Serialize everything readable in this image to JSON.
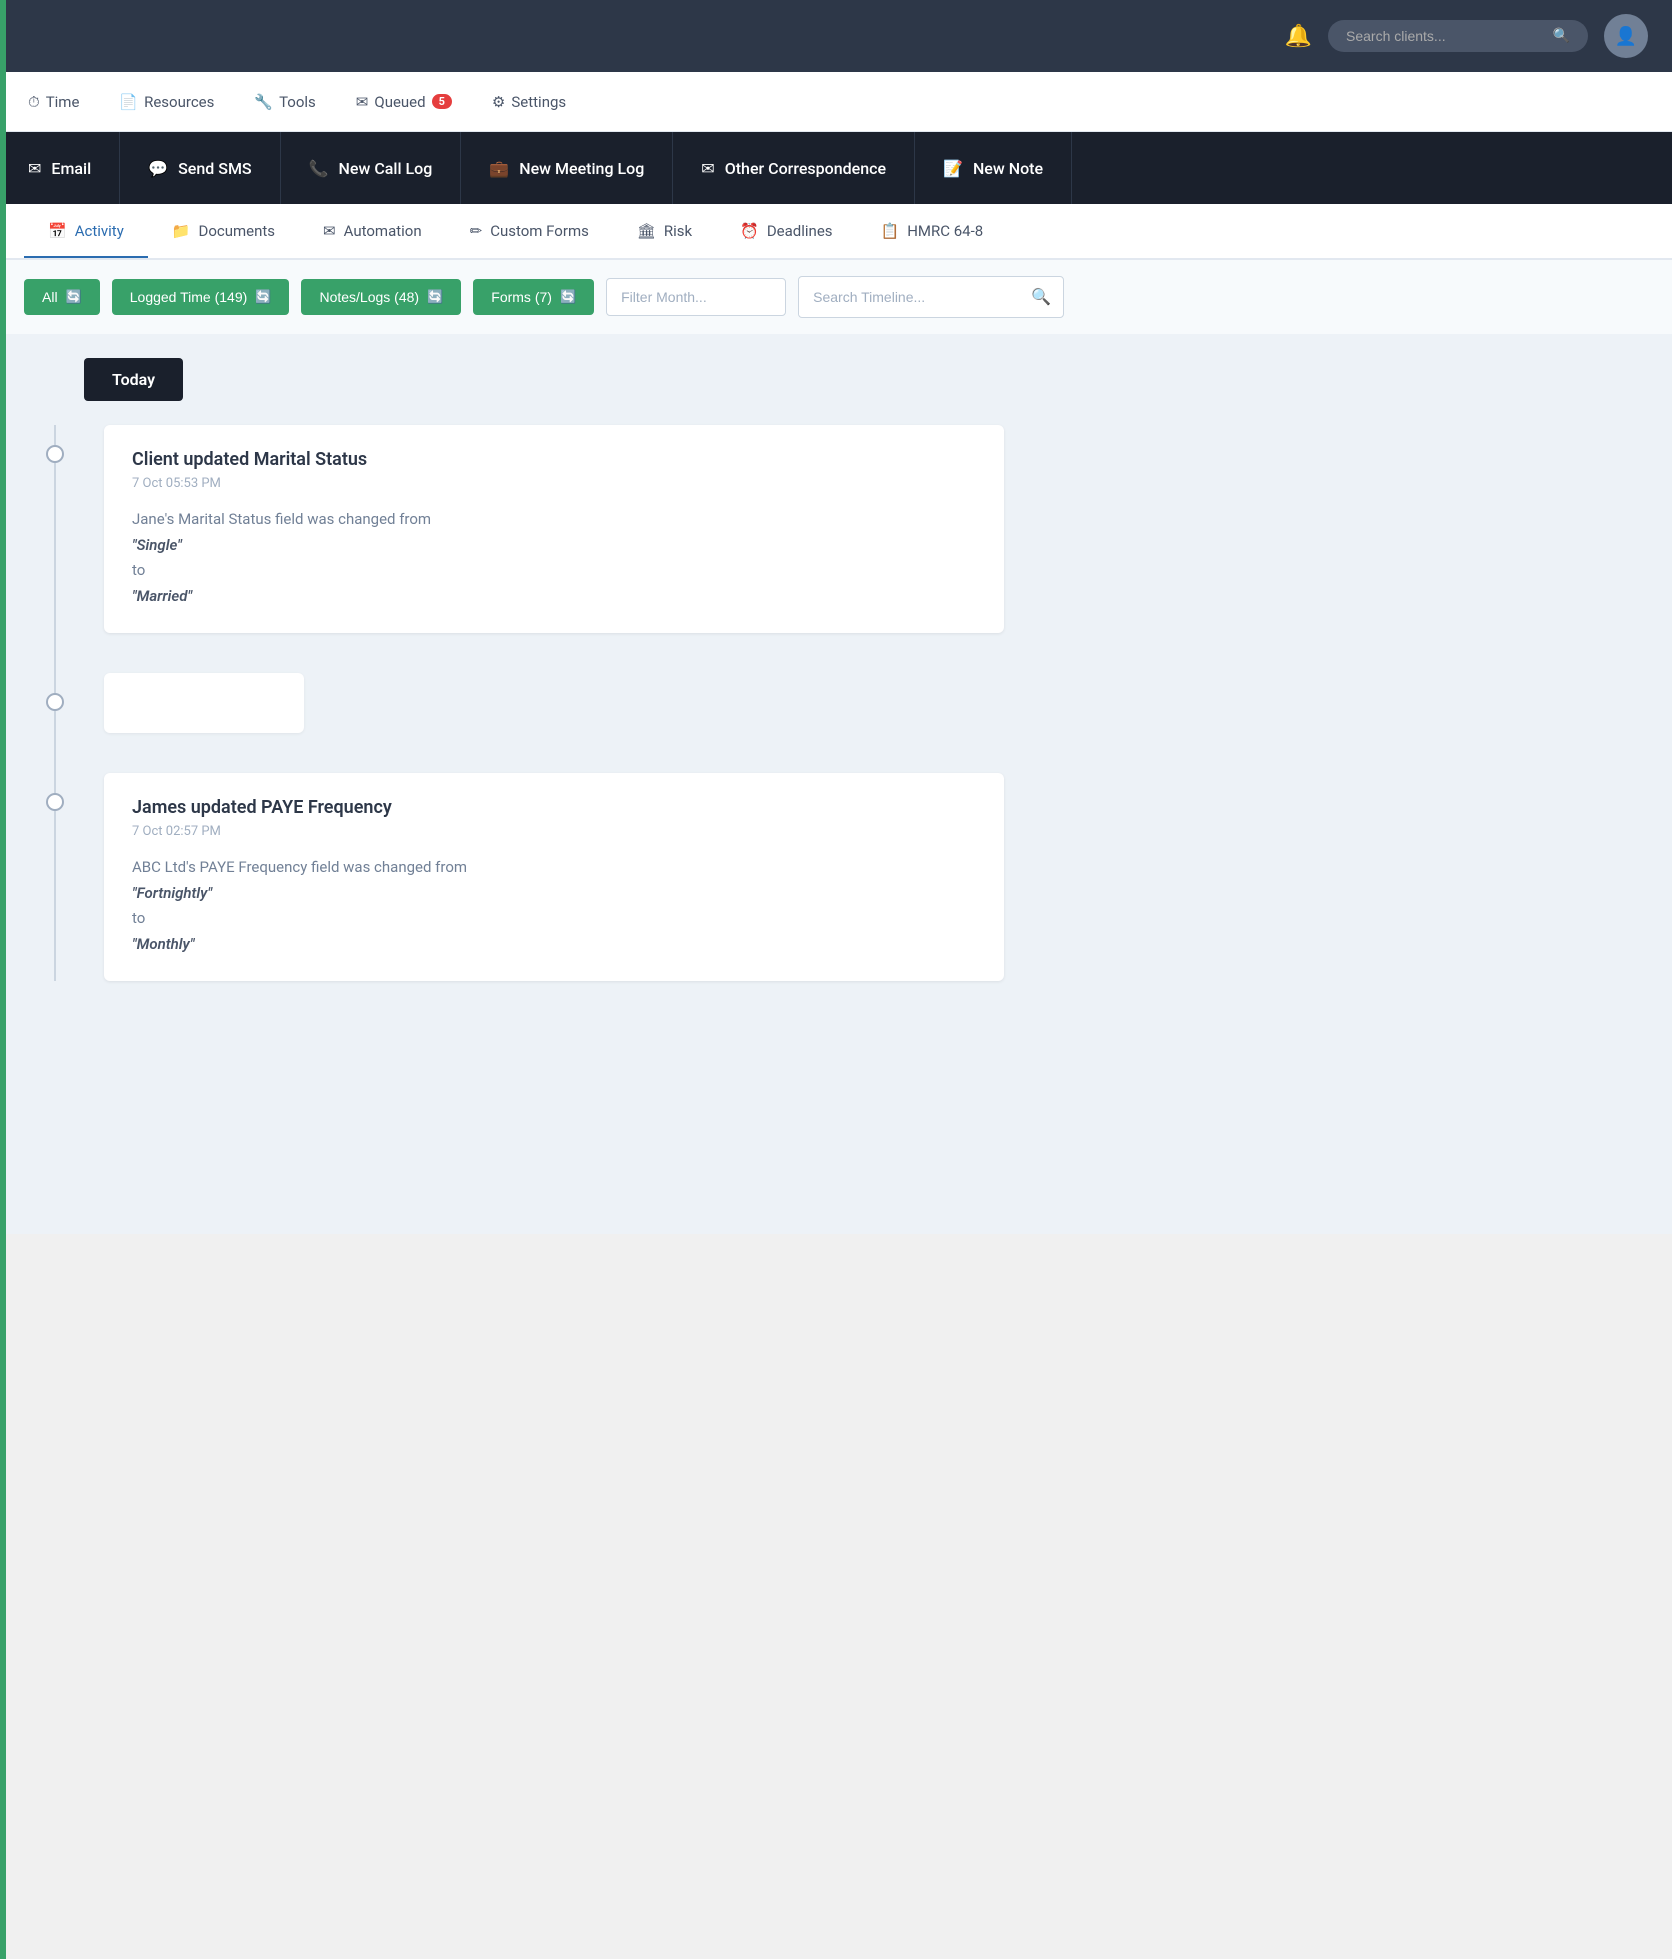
{
  "topbar": {
    "search_placeholder": "Search clients...",
    "notification_icon": "🔔",
    "search_icon": "🔍"
  },
  "second_nav": {
    "items": [
      {
        "id": "time",
        "icon": "⏱",
        "label": "Time"
      },
      {
        "id": "resources",
        "icon": "📄",
        "label": "Resources"
      },
      {
        "id": "tools",
        "icon": "🔧",
        "label": "Tools"
      },
      {
        "id": "queued",
        "icon": "✉",
        "label": "Queued",
        "badge": "5"
      },
      {
        "id": "settings",
        "icon": "⚙",
        "label": "Settings"
      }
    ]
  },
  "action_bar": {
    "buttons": [
      {
        "id": "email",
        "icon": "✉",
        "label": "Email"
      },
      {
        "id": "send-sms",
        "icon": "💬",
        "label": "Send SMS"
      },
      {
        "id": "new-call-log",
        "icon": "📞",
        "label": "New Call Log"
      },
      {
        "id": "new-meeting-log",
        "icon": "💼",
        "label": "New Meeting Log"
      },
      {
        "id": "other-correspondence",
        "icon": "✉",
        "label": "Other Correspondence"
      },
      {
        "id": "new-note",
        "icon": "📝",
        "label": "New Note"
      }
    ]
  },
  "tabs": {
    "items": [
      {
        "id": "activity",
        "icon": "📅",
        "label": "Activity"
      },
      {
        "id": "documents",
        "icon": "📁",
        "label": "Documents"
      },
      {
        "id": "automation",
        "icon": "✉",
        "label": "Automation"
      },
      {
        "id": "custom-forms",
        "icon": "✏",
        "label": "Custom Forms"
      },
      {
        "id": "risk",
        "icon": "🏛",
        "label": "Risk"
      },
      {
        "id": "deadlines",
        "icon": "⏰",
        "label": "Deadlines"
      },
      {
        "id": "hmrc-64-8",
        "icon": "📋",
        "label": "HMRC 64-8"
      }
    ]
  },
  "filter_row": {
    "btn_all": "All",
    "btn_logged_time": "Logged Time (149)",
    "btn_notes_logs": "Notes/Logs (48)",
    "btn_forms": "Forms (7)",
    "filter_month_placeholder": "Filter Month...",
    "search_timeline_placeholder": "Search Timeline..."
  },
  "timeline": {
    "today_label": "Today",
    "entries": [
      {
        "id": "entry-1",
        "title": "Client updated Marital Status",
        "time": "7 Oct 05:53 PM",
        "body_prefix": "Jane's Marital Status field was changed from",
        "from_value": "\"Single\"",
        "to_label": "to",
        "to_value": "\"Married\""
      },
      {
        "id": "entry-2",
        "title": "James updated PAYE Frequency",
        "time": "7 Oct 02:57 PM",
        "body_prefix": "ABC Ltd's PAYE Frequency field was changed from",
        "from_value": "\"Fortnightly\"",
        "to_label": "to",
        "to_value": "\"Monthly\""
      }
    ]
  }
}
